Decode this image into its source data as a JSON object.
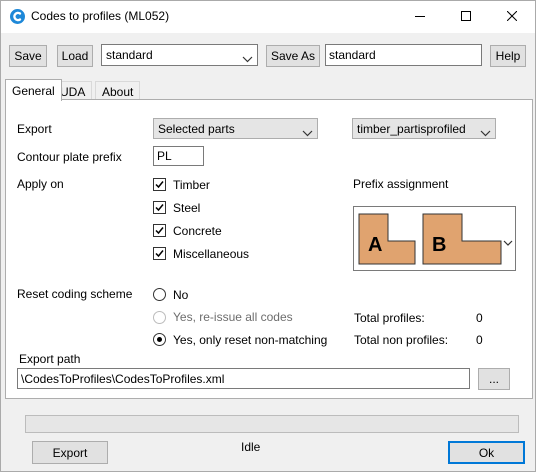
{
  "window": {
    "title": "Codes to profiles (ML052)"
  },
  "toolbar": {
    "save_label": "Save",
    "load_label": "Load",
    "preset_value": "standard",
    "save_as_label": "Save As",
    "save_as_value": "standard",
    "help_label": "Help"
  },
  "tabs": [
    {
      "label": "General",
      "active": true
    },
    {
      "label": "UDA",
      "active": false
    },
    {
      "label": "About",
      "active": false
    }
  ],
  "general": {
    "export_label": "Export",
    "export_value": "Selected parts",
    "profile_value": "timber_partisprofiled",
    "contour_prefix_label": "Contour plate prefix",
    "contour_prefix_value": "PL",
    "apply_on_label": "Apply on",
    "apply_on": [
      {
        "label": "Timber",
        "checked": true
      },
      {
        "label": "Steel",
        "checked": true
      },
      {
        "label": "Concrete",
        "checked": true
      },
      {
        "label": "Miscellaneous",
        "checked": true
      }
    ],
    "prefix_assignment_label": "Prefix assignment",
    "prefix_assignment_glyphs": [
      "A",
      "B"
    ],
    "reset_label": "Reset coding scheme",
    "reset_options": [
      {
        "label": "No",
        "checked": false,
        "enabled": true
      },
      {
        "label": "Yes, re-issue all codes",
        "checked": false,
        "enabled": false
      },
      {
        "label": "Yes, only reset non-matching",
        "checked": true,
        "enabled": true
      }
    ],
    "total_profiles_label": "Total profiles:",
    "total_profiles_value": "0",
    "total_non_profiles_label": "Total non profiles:",
    "total_non_profiles_value": "0",
    "export_path_label": "Export path",
    "export_path_value": "\\CodesToProfiles\\CodesToProfiles.xml",
    "browse_label": "..."
  },
  "footer": {
    "export_label": "Export",
    "status": "Idle",
    "ok_label": "Ok"
  },
  "colors": {
    "prefix_tile": "#e0a36f",
    "accent": "#0078d7"
  }
}
